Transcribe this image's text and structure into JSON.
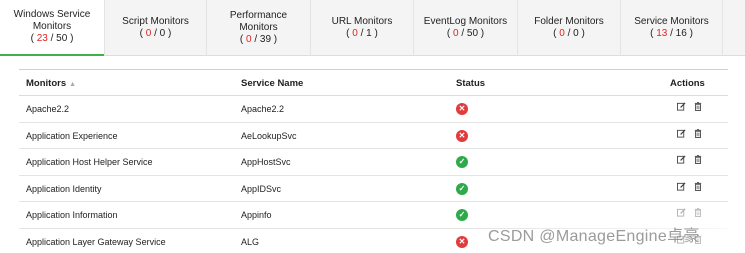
{
  "tabs": [
    {
      "title": "Windows Service Monitors",
      "down": "23",
      "total": "50"
    },
    {
      "title": "Script Monitors",
      "down": "0",
      "total": "0"
    },
    {
      "title": "Performance Monitors",
      "down": "0",
      "total": "39"
    },
    {
      "title": "URL Monitors",
      "down": "0",
      "total": "1"
    },
    {
      "title": "EventLog Monitors",
      "down": "0",
      "total": "50"
    },
    {
      "title": "Folder Monitors",
      "down": "0",
      "total": "0"
    },
    {
      "title": "Service Monitors",
      "down": "13",
      "total": "16"
    }
  ],
  "table": {
    "headers": {
      "monitors": "Monitors",
      "service_name": "Service Name",
      "status": "Status",
      "actions": "Actions"
    },
    "rows": [
      {
        "monitor": "Apache2.2",
        "service": "Apache2.2",
        "status": "down"
      },
      {
        "monitor": "Application Experience",
        "service": "AeLookupSvc",
        "status": "down"
      },
      {
        "monitor": "Application Host Helper Service",
        "service": "AppHostSvc",
        "status": "up"
      },
      {
        "monitor": "Application Identity",
        "service": "AppIDSvc",
        "status": "up"
      },
      {
        "monitor": "Application Information",
        "service": "Appinfo",
        "status": "up"
      },
      {
        "monitor": "Application Layer Gateway Service",
        "service": "ALG",
        "status": "down"
      }
    ]
  },
  "icons": {
    "status_down": "x-circle-icon",
    "status_up": "check-circle-icon",
    "edit": "edit-icon",
    "delete": "trash-icon",
    "sort": "sort-up-icon"
  },
  "colors": {
    "active_tab_underline": "#3fb14a",
    "down_count": "#e02424",
    "status_down": "#e03c3c",
    "status_up": "#2eaa4a"
  },
  "watermark": "CSDN @ManageEngine卓豪"
}
